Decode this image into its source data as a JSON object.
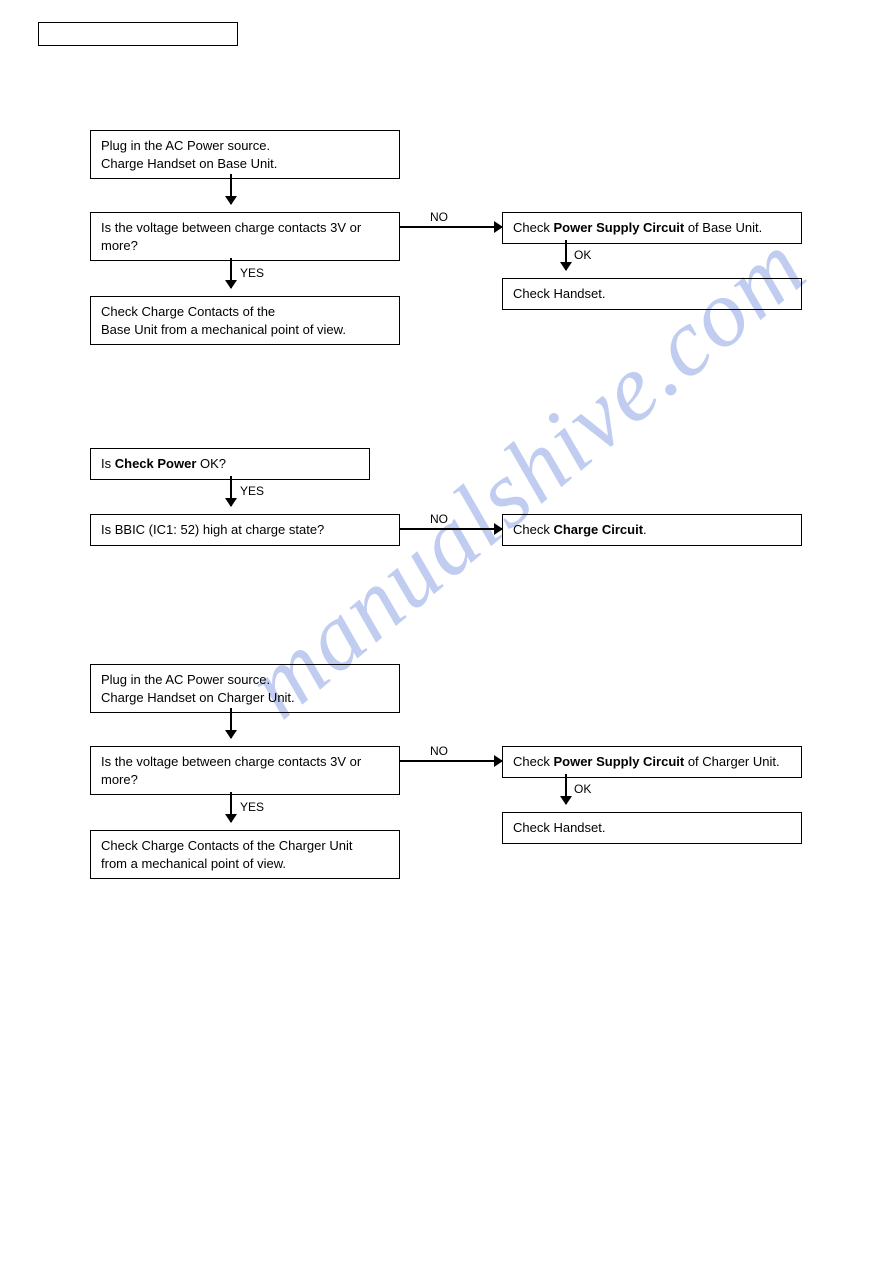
{
  "watermark": "manualshive.com",
  "section1": {
    "step1_line1": "Plug in the AC Power source.",
    "step1_line2": "Charge Handset on Base Unit.",
    "q1_line1": "Is the voltage between charge contacts 3V or",
    "q1_line2": "more?",
    "yes": "YES",
    "no": "NO",
    "r_yes_line1": "Check Charge Contacts of the",
    "r_yes_line2": "Base Unit from a mechanical point of view.",
    "r_no_pre": "Check ",
    "r_no_bold": "Power Supply Circuit",
    "r_no_post": " of Base Unit.",
    "ok": "OK",
    "r_no2": "Check Handset."
  },
  "section2": {
    "q1_pre": "Is ",
    "q1_bold": "Check Power",
    "q1_post": " OK?",
    "yes": "YES",
    "q2": "Is BBIC (IC1: 52) high at charge state?",
    "no": "NO",
    "r_no_pre": "Check ",
    "r_no_bold": "Charge Circuit",
    "r_no_post": "."
  },
  "section3": {
    "step1_line1": "Plug in the AC Power source.",
    "step1_line2": "Charge Handset on Charger Unit.",
    "q1_line1": "Is the voltage between charge contacts 3V or",
    "q1_line2": "more?",
    "yes": "YES",
    "no": "NO",
    "r_yes_line1": "Check Charge Contacts of the Charger Unit",
    "r_yes_line2": "from a mechanical point of view.",
    "r_no_pre": "Check ",
    "r_no_bold": "Power Supply Circuit",
    "r_no_post": " of Charger Unit.",
    "ok": "OK",
    "r_no2": "Check Handset."
  }
}
